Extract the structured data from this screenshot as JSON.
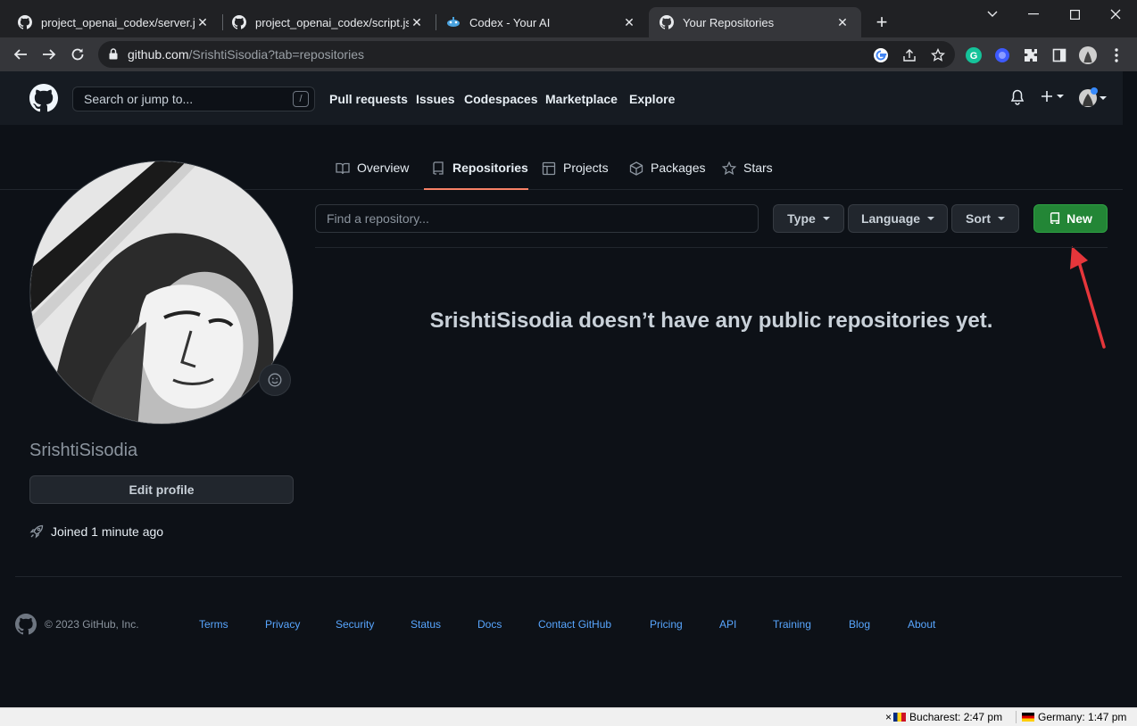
{
  "browser": {
    "tabs": [
      {
        "title": "project_openai_codex/server.js at"
      },
      {
        "title": "project_openai_codex/script.js at"
      },
      {
        "title": "Codex - Your AI"
      },
      {
        "title": "Your Repositories"
      }
    ],
    "url_host": "github.com",
    "url_path": "/SrishtiSisodia?tab=repositories"
  },
  "gh_header": {
    "search_placeholder": "Search or jump to...",
    "search_key": "/",
    "nav": [
      "Pull requests",
      "Issues",
      "Codespaces",
      "Marketplace",
      "Explore"
    ]
  },
  "profile_tabs": {
    "overview": "Overview",
    "repositories": "Repositories",
    "projects": "Projects",
    "packages": "Packages",
    "stars": "Stars"
  },
  "profile": {
    "username": "SrishtiSisodia",
    "edit_label": "Edit profile",
    "joined": "Joined 1 minute ago"
  },
  "repos": {
    "find_placeholder": "Find a repository...",
    "type_label": "Type",
    "language_label": "Language",
    "sort_label": "Sort",
    "new_label": "New",
    "empty_message": "SrishtiSisodia doesn’t have any public repositories yet."
  },
  "footer": {
    "copyright": "© 2023 GitHub, Inc.",
    "links": [
      "Terms",
      "Privacy",
      "Security",
      "Status",
      "Docs",
      "Contact GitHub",
      "Pricing",
      "API",
      "Training",
      "Blog",
      "About"
    ]
  },
  "statusbar": {
    "close_mark": "×",
    "clock1": "Bucharest: 2:47 pm",
    "clock2": "Germany: 1:47 pm"
  },
  "colors": {
    "accent_tab": "#f78166",
    "new_button": "#238636",
    "link": "#58a6ff",
    "annotation_arrow": "#e5363b"
  }
}
